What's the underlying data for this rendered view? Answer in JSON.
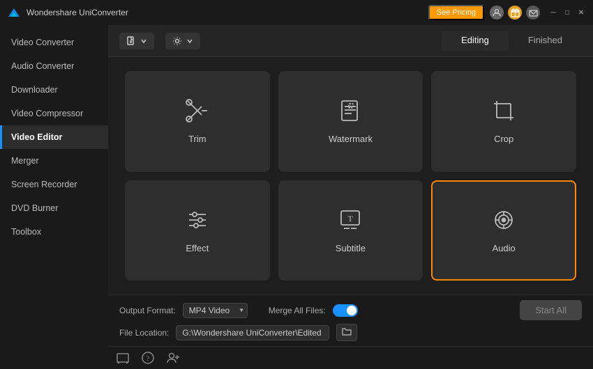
{
  "app": {
    "title": "Wondershare UniConverter",
    "pricing_btn": "See Pricing"
  },
  "sidebar": {
    "items": [
      {
        "id": "video-converter",
        "label": "Video Converter",
        "active": false
      },
      {
        "id": "audio-converter",
        "label": "Audio Converter",
        "active": false
      },
      {
        "id": "downloader",
        "label": "Downloader",
        "active": false
      },
      {
        "id": "video-compressor",
        "label": "Video Compressor",
        "active": false
      },
      {
        "id": "video-editor",
        "label": "Video Editor",
        "active": true
      },
      {
        "id": "merger",
        "label": "Merger",
        "active": false
      },
      {
        "id": "screen-recorder",
        "label": "Screen Recorder",
        "active": false
      },
      {
        "id": "dvd-burner",
        "label": "DVD Burner",
        "active": false
      },
      {
        "id": "toolbox",
        "label": "Toolbox",
        "active": false
      }
    ]
  },
  "tabs": {
    "editing": "Editing",
    "finished": "Finished"
  },
  "grid": {
    "cards": [
      {
        "id": "trim",
        "label": "Trim",
        "selected": false
      },
      {
        "id": "watermark",
        "label": "Watermark",
        "selected": false
      },
      {
        "id": "crop",
        "label": "Crop",
        "selected": false
      },
      {
        "id": "effect",
        "label": "Effect",
        "selected": false
      },
      {
        "id": "subtitle",
        "label": "Subtitle",
        "selected": false
      },
      {
        "id": "audio",
        "label": "Audio",
        "selected": true
      }
    ]
  },
  "bottom": {
    "output_format_label": "Output Format:",
    "output_format_value": "MP4 Video",
    "merge_label": "Merge All Files:",
    "file_location_label": "File Location:",
    "file_location_value": "G:\\Wondershare UniConverter\\Edited",
    "start_all_btn": "Start All"
  }
}
